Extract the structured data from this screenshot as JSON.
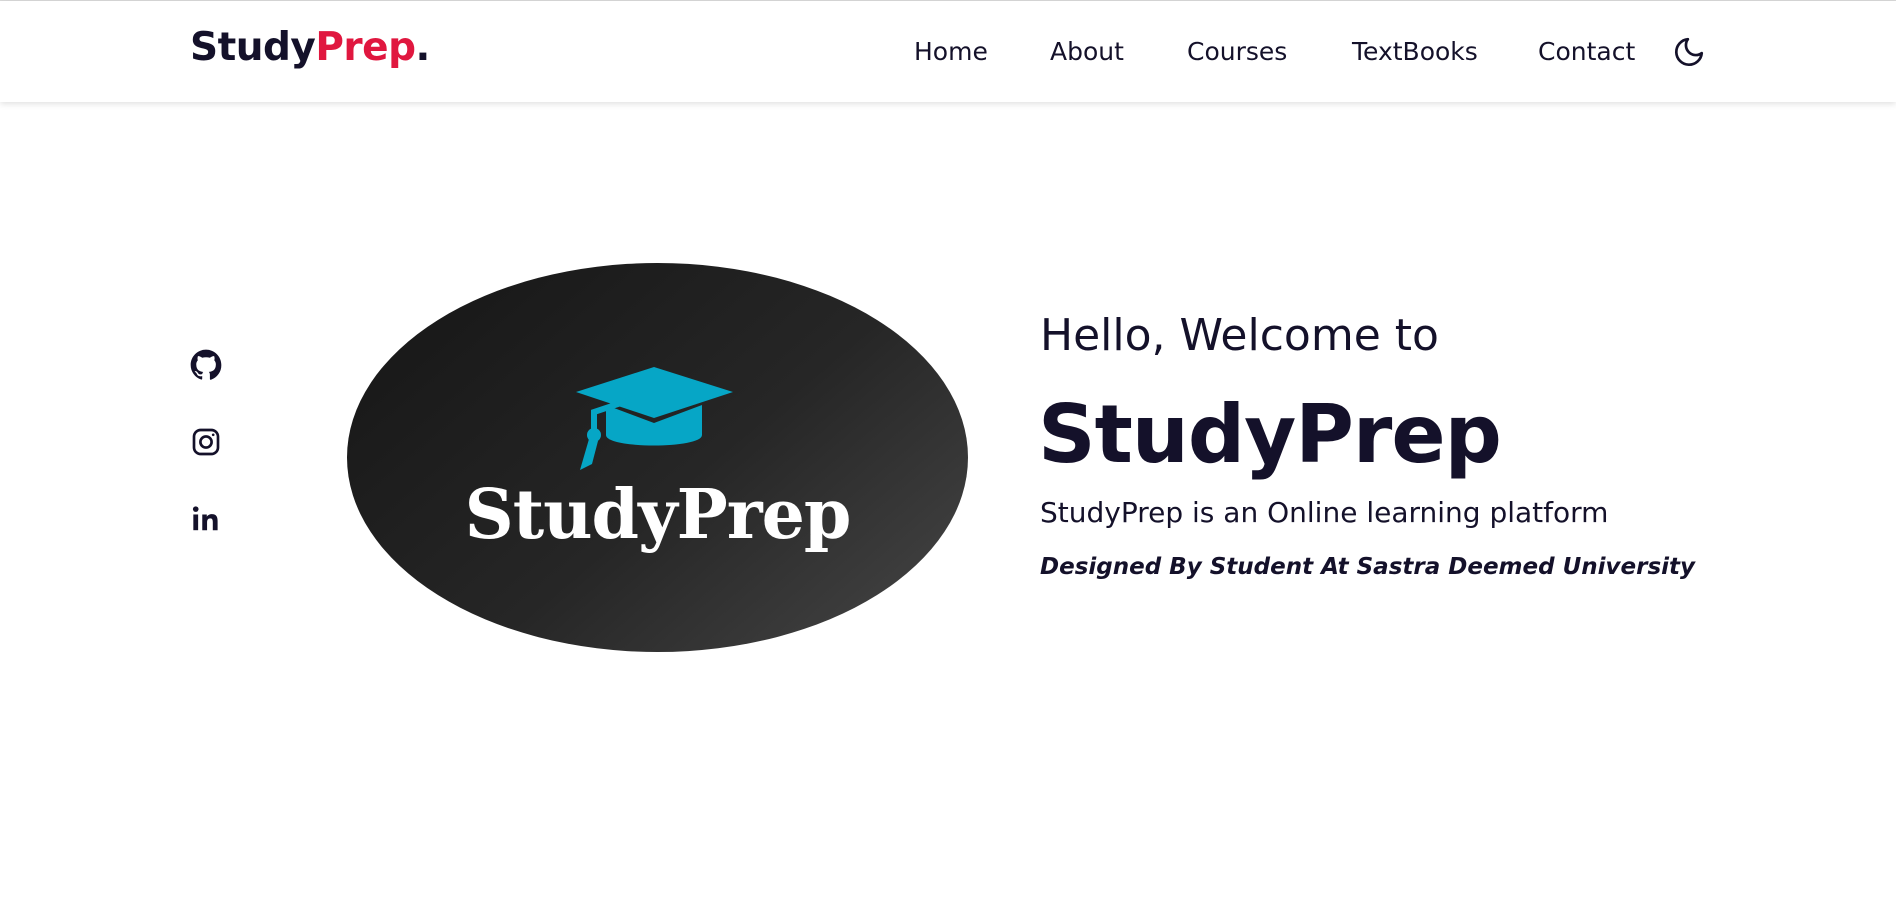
{
  "header": {
    "brand": {
      "part1": "Study",
      "part2": "Prep",
      "dot": "."
    },
    "nav": [
      {
        "label": "Home"
      },
      {
        "label": "About"
      },
      {
        "label": "Courses"
      },
      {
        "label": "TextBooks"
      },
      {
        "label": "Contact"
      }
    ],
    "theme_toggle_icon": "moon-icon"
  },
  "socials": [
    {
      "icon": "github-icon"
    },
    {
      "icon": "instagram-icon"
    },
    {
      "icon": "linkedin-icon"
    }
  ],
  "hero": {
    "logo": {
      "icon": "graduation-cap-icon",
      "wordmark": "StudyPrep"
    },
    "greeting": "Hello, Welcome to",
    "title": "StudyPrep",
    "description": "StudyPrep is an Online learning platform",
    "credit": "Designed By Student At Sastra Deemed University"
  },
  "colors": {
    "accent": "#e0173f",
    "text": "#14112a",
    "cap": "#06a6c6",
    "oval_dark": "#1a1a1a"
  }
}
